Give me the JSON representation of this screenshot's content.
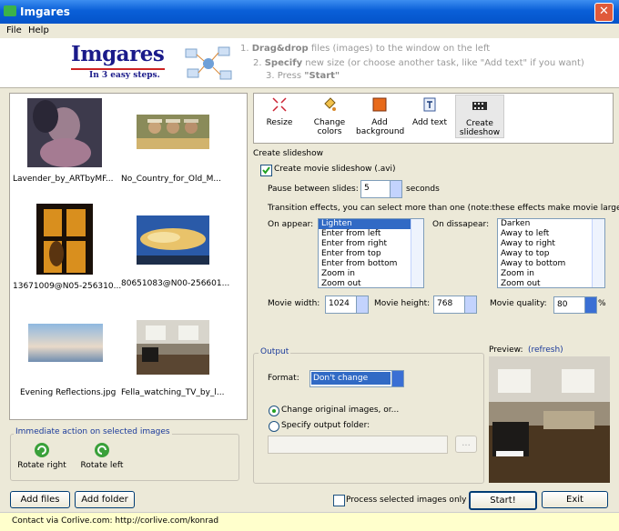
{
  "window": {
    "title": "Imgares",
    "close_glyph": "✕"
  },
  "menu": {
    "file": "File",
    "help": "Help"
  },
  "banner": {
    "logo": "Imgares",
    "tagline": "In 3 easy steps.",
    "step1_num": "1.",
    "step1_bold": "Drag&drop",
    "step1_text": "files (images)  to the window on the left",
    "step2_num": "2.",
    "step2_bold": "Specify",
    "step2_text": "new size (or choose another task, like \"Add text\" if you want)",
    "step3_num": "3.",
    "step3_pre": "Press",
    "step3_bold": "\"Start\""
  },
  "images": [
    {
      "caption": "Lavender_by_ARTbyMF..."
    },
    {
      "caption": "No_Country_for_Old_M..."
    },
    {
      "caption": "13671009@N05-256310..."
    },
    {
      "caption": "80651083@N00-256601..."
    },
    {
      "caption": "Evening Reflections.jpg"
    },
    {
      "caption": "Fella_watching_TV_by_l..."
    }
  ],
  "immediate": {
    "label": "Immediate action on selected images",
    "rotate_right": "Rotate right",
    "rotate_left": "Rotate left"
  },
  "bottom_left": {
    "add_files": "Add files",
    "add_folder": "Add folder"
  },
  "tools": [
    {
      "label1": "Resize",
      "label2": "",
      "icon": "resize-arrows-icon"
    },
    {
      "label1": "Change",
      "label2": "colors",
      "icon": "paint-bucket-icon"
    },
    {
      "label1": "Add",
      "label2": "background",
      "icon": "background-icon"
    },
    {
      "label1": "Add text",
      "label2": "",
      "icon": "text-icon"
    },
    {
      "label1": "Create",
      "label2": "slideshow",
      "icon": "film-icon"
    }
  ],
  "slideshow": {
    "section_title": "Create slideshow",
    "create_avi_label": "Create movie slideshow (.avi)",
    "create_avi_checked": true,
    "pause_label": "Pause between slides:",
    "pause_value": "5",
    "pause_unit": "seconds",
    "transition_note": "Transition effects, you can select more than one (note:these effects make movie larger)",
    "on_appear_label": "On appear:",
    "on_appear_items": [
      "Lighten",
      "Enter from left",
      "Enter from right",
      "Enter from top",
      "Enter from bottom",
      "Zoom in",
      "Zoom out"
    ],
    "on_disappear_label": "On dissapear:",
    "on_disappear_items": [
      "Darken",
      "Away to left",
      "Away to right",
      "Away to top",
      "Away to bottom",
      "Zoom in",
      "Zoom out"
    ],
    "movie_width_label": "Movie width:",
    "movie_width": "1024",
    "movie_height_label": "Movie height:",
    "movie_height": "768",
    "movie_quality_label": "Movie quality:",
    "movie_quality": "80",
    "quality_unit": "%"
  },
  "output": {
    "group_label": "Output",
    "format_label": "Format:",
    "format_value": "Don't change",
    "change_original": "Change original images, or...",
    "specify_folder": "Specify output folder:",
    "browse": "..."
  },
  "preview": {
    "label": "Preview:",
    "refresh": "(refresh)"
  },
  "actions": {
    "process_selected": "Process selected images only",
    "start": "Start!",
    "exit": "Exit"
  },
  "footer": {
    "contact": "Contact via Corlive.com: http://corlive.com/konrad"
  },
  "colors": {
    "title_bar": "#0a5fd8",
    "selection": "#316ac5",
    "footer_bg": "#ffffcc",
    "group_label": "#1a3a9a"
  }
}
